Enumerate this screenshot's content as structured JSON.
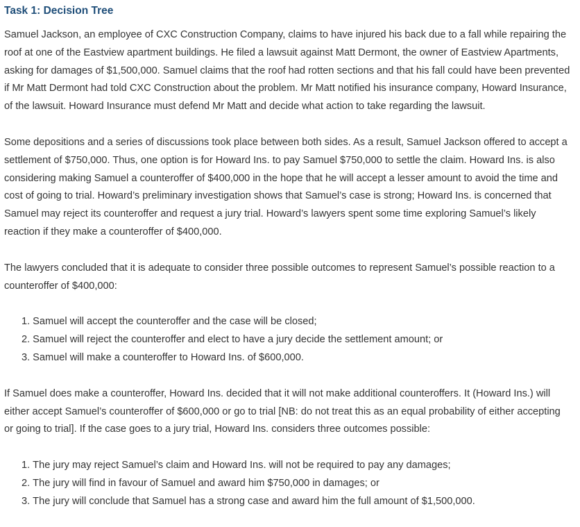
{
  "title": "Task 1: Decision Tree",
  "paragraphs": {
    "p1": "Samuel Jackson, an employee of CXC Construction Company, claims to have injured his back due to a fall while repairing the roof at one of the Eastview apartment buildings. He filed a lawsuit against Matt Dermont, the owner of Eastview Apartments, asking for damages of $1,500,000. Samuel claims that the roof had rotten sections and that his fall could have been prevented if Mr Matt Dermont had told CXC Construction about the problem. Mr Matt notified his insurance company, Howard Insurance, of the lawsuit. Howard Insurance must defend Mr Matt and decide what action to take regarding the lawsuit.",
    "p2": "Some depositions and a series of discussions took place between both sides. As a result, Samuel Jackson offered to accept a settlement of $750,000. Thus, one option is for Howard Ins. to pay Samuel $750,000 to settle the claim. Howard Ins. is also considering making Samuel a counteroffer of $400,000 in the hope that he will accept a lesser amount to avoid the time and cost of going to trial. Howard’s preliminary investigation shows that Samuel’s case is strong; Howard Ins. is concerned that Samuel may reject its counteroffer and request a jury trial. Howard’s lawyers spent some time exploring Samuel’s likely reaction if they make a counteroffer of $400,000.",
    "p3": "The lawyers concluded that it is adequate to consider three possible outcomes to represent Samuel’s possible reaction to a counteroffer of $400,000:",
    "p4": "If Samuel does make a counteroffer, Howard Ins. decided that it will not make additional counteroffers. It (Howard Ins.) will either accept Samuel’s counteroffer of $600,000 or go to trial [NB: do not treat this as an equal probability of either accepting or going to trial]. If the case goes to a jury trial, Howard Ins. considers three outcomes possible:"
  },
  "reaction_outcomes": [
    {
      "num": "1.",
      "text": "Samuel will accept the counteroffer and the case will be closed;"
    },
    {
      "num": "2.",
      "text": "Samuel will reject the counteroffer and elect to have a jury decide the settlement amount; or"
    },
    {
      "num": "3.",
      "text": "Samuel will make a counteroffer to Howard Ins. of $600,000."
    }
  ],
  "trial_outcomes": [
    {
      "num": "1.",
      "text": "The jury may reject Samuel’s claim and Howard Ins. will not be required to pay any damages;"
    },
    {
      "num": "2.",
      "text": "The jury will find in favour of Samuel and award him $750,000 in damages; or"
    },
    {
      "num": "3.",
      "text": "The jury will conclude that Samuel has a strong case and award him the full amount of $1,500,000."
    }
  ]
}
